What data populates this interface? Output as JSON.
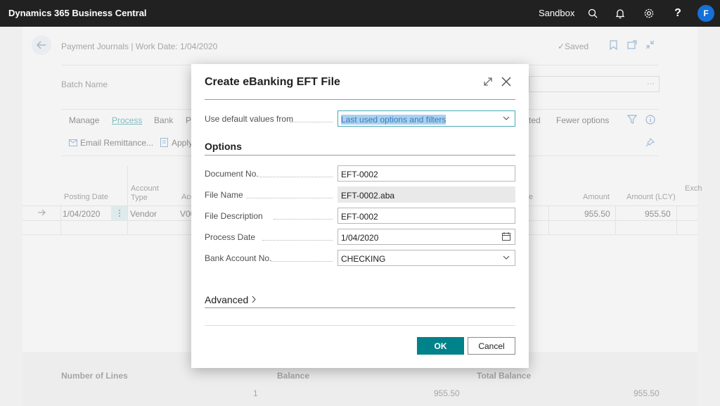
{
  "appbar": {
    "title": "Dynamics 365 Business Central",
    "environment": "Sandbox",
    "avatar_initial": "F",
    "help_label": "?"
  },
  "page": {
    "breadcrumb": "Payment Journals | Work Date: 1/04/2020",
    "saved_label": "Saved",
    "batch_name_label": "Batch Name",
    "batch_more": "···",
    "actions": {
      "manage": "Manage",
      "process": "Process",
      "bank": "Bank",
      "partial_p": "P",
      "partial_ted": "ted",
      "fewer_options": "Fewer options",
      "email_remittance": "Email Remittance...",
      "apply": "Apply"
    },
    "grid": {
      "headers": {
        "posting_date": "Posting Date",
        "account_type_1": "Account",
        "account_type_2": "Type",
        "acc_partial": "Acc",
        "amount": "Amount",
        "amount_lcy": "Amount (LCY)",
        "exch_partial": "Exch",
        "e_partial": "e"
      },
      "row": {
        "posting_date": "1/04/2020",
        "account_type": "Vendor",
        "account_partial": "V00",
        "amount": "955.50",
        "amount_lcy": "955.50"
      }
    },
    "totals": {
      "lines_label": "Number of Lines",
      "lines_value": "1",
      "balance_label": "Balance",
      "balance_value": "955.50",
      "total_balance_label": "Total Balance",
      "total_balance_value": "955.50"
    }
  },
  "dialog": {
    "title": "Create eBanking EFT File",
    "defaults_label": "Use default values from",
    "defaults_value": "Last used options and filters",
    "options_heading": "Options",
    "fields": {
      "document_no_label": "Document No.",
      "document_no_value": "EFT-0002",
      "file_name_label": "File Name",
      "file_name_value": "EFT-0002.aba",
      "file_description_label": "File Description",
      "file_description_value": "EFT-0002",
      "process_date_label": "Process Date",
      "process_date_value": "1/04/2020",
      "bank_account_label": "Bank Account No.",
      "bank_account_value": "CHECKING"
    },
    "advanced_heading": "Advanced",
    "ok_label": "OK",
    "cancel_label": "Cancel"
  },
  "colors": {
    "appbar": "#212121",
    "accent": "#00828a",
    "avatar": "#1570d8"
  },
  "icons": [
    "search-icon",
    "bell-icon",
    "gear-icon",
    "back-arrow-icon",
    "bookmark-icon",
    "open-new-icon",
    "collapse-icon",
    "filter-icon",
    "info-icon",
    "pin-icon",
    "expand-icon",
    "close-icon",
    "chevron-down-icon",
    "calendar-icon",
    "chevron-right-icon",
    "row-arrow-icon",
    "row-menu-icon",
    "email-icon",
    "apply-icon"
  ]
}
